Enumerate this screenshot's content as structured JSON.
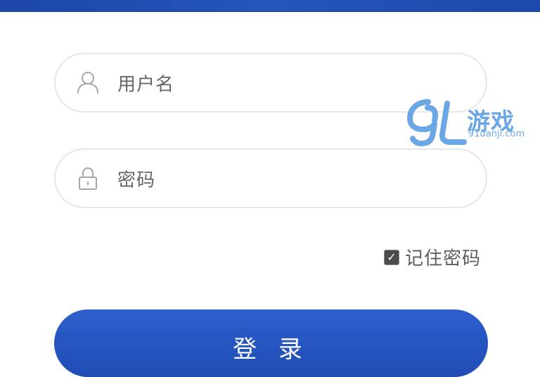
{
  "form": {
    "username": {
      "placeholder": "用户名",
      "icon": "user-icon"
    },
    "password": {
      "placeholder": "密码",
      "icon": "lock-icon"
    },
    "remember_me": {
      "label": "记住密码",
      "checked": true
    },
    "login_button": {
      "label": "登 录"
    }
  },
  "watermark": {
    "brand": "游戏",
    "domain": "91danji.com"
  },
  "colors": {
    "banner": "#1f4cb4",
    "button": "#1f4cb4",
    "field_border": "#e7e7ea",
    "watermark": "#6ca7e5"
  }
}
